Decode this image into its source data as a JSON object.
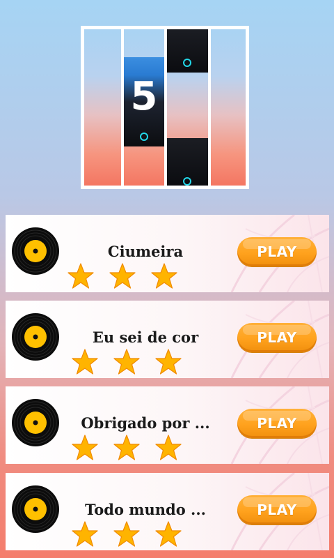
{
  "logo": {
    "number": "5"
  },
  "songs": [
    {
      "title": "Ciumeira",
      "stars": 3,
      "play_label": "PLAY"
    },
    {
      "title": "Eu sei de cor",
      "stars": 3,
      "play_label": "PLAY"
    },
    {
      "title": "Obrigado por ...",
      "stars": 3,
      "play_label": "PLAY"
    },
    {
      "title": "Todo mundo ...",
      "stars": 3,
      "play_label": "PLAY"
    }
  ],
  "colors": {
    "play_button": "#ffa21d",
    "star": "#ffb400",
    "vinyl_label": "#ffc000",
    "tile_ring": "#22d7e8"
  }
}
